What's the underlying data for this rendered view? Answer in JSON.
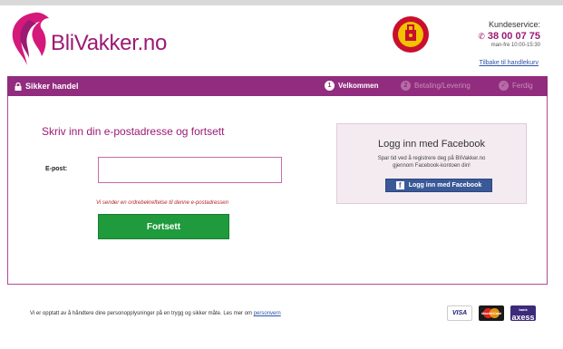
{
  "header": {
    "logo_text": "BliVakker.no",
    "trust_badge": "trygg-e-handel-badge",
    "service_label": "Kundeservice:",
    "phone": "38 00 07 75",
    "hours": "man-fre 10:00-15:30",
    "back_link": "Tilbake til handlekurv"
  },
  "stepbar": {
    "secure_label": "Sikker handel",
    "steps": [
      {
        "num": "1",
        "label": "Velkommen",
        "active": true
      },
      {
        "num": "2",
        "label": "Betaling/Levering",
        "active": false
      },
      {
        "num": "✓",
        "label": "Ferdig",
        "active": false
      }
    ]
  },
  "form": {
    "heading": "Skriv inn din e-postadresse og fortsett",
    "email_label": "E-post:",
    "email_value": "",
    "note": "Vi sender en ordrebekreftelse til denne e-postadressen",
    "continue_label": "Fortsett"
  },
  "facebook": {
    "title": "Logg inn med Facebook",
    "desc_line1": "Spar tid ved å registrere deg på BliVakker.no",
    "desc_line2": "gjennom Facebook-kontoen din!",
    "button_label": "Logg inn med Facebook",
    "button_icon": "facebook-f-icon"
  },
  "footer": {
    "privacy_text": "Vi er opptatt av å håndtere dine personopplysninger på en trygg og sikker måte. Les mer om ",
    "privacy_link": "personvern",
    "cards": [
      "VISA",
      "MasterCard",
      "axess"
    ]
  },
  "colors": {
    "brand": "#9b1a73",
    "stepbar": "#912c7e",
    "continue": "#1f9a3c",
    "facebook": "#3b5998"
  }
}
